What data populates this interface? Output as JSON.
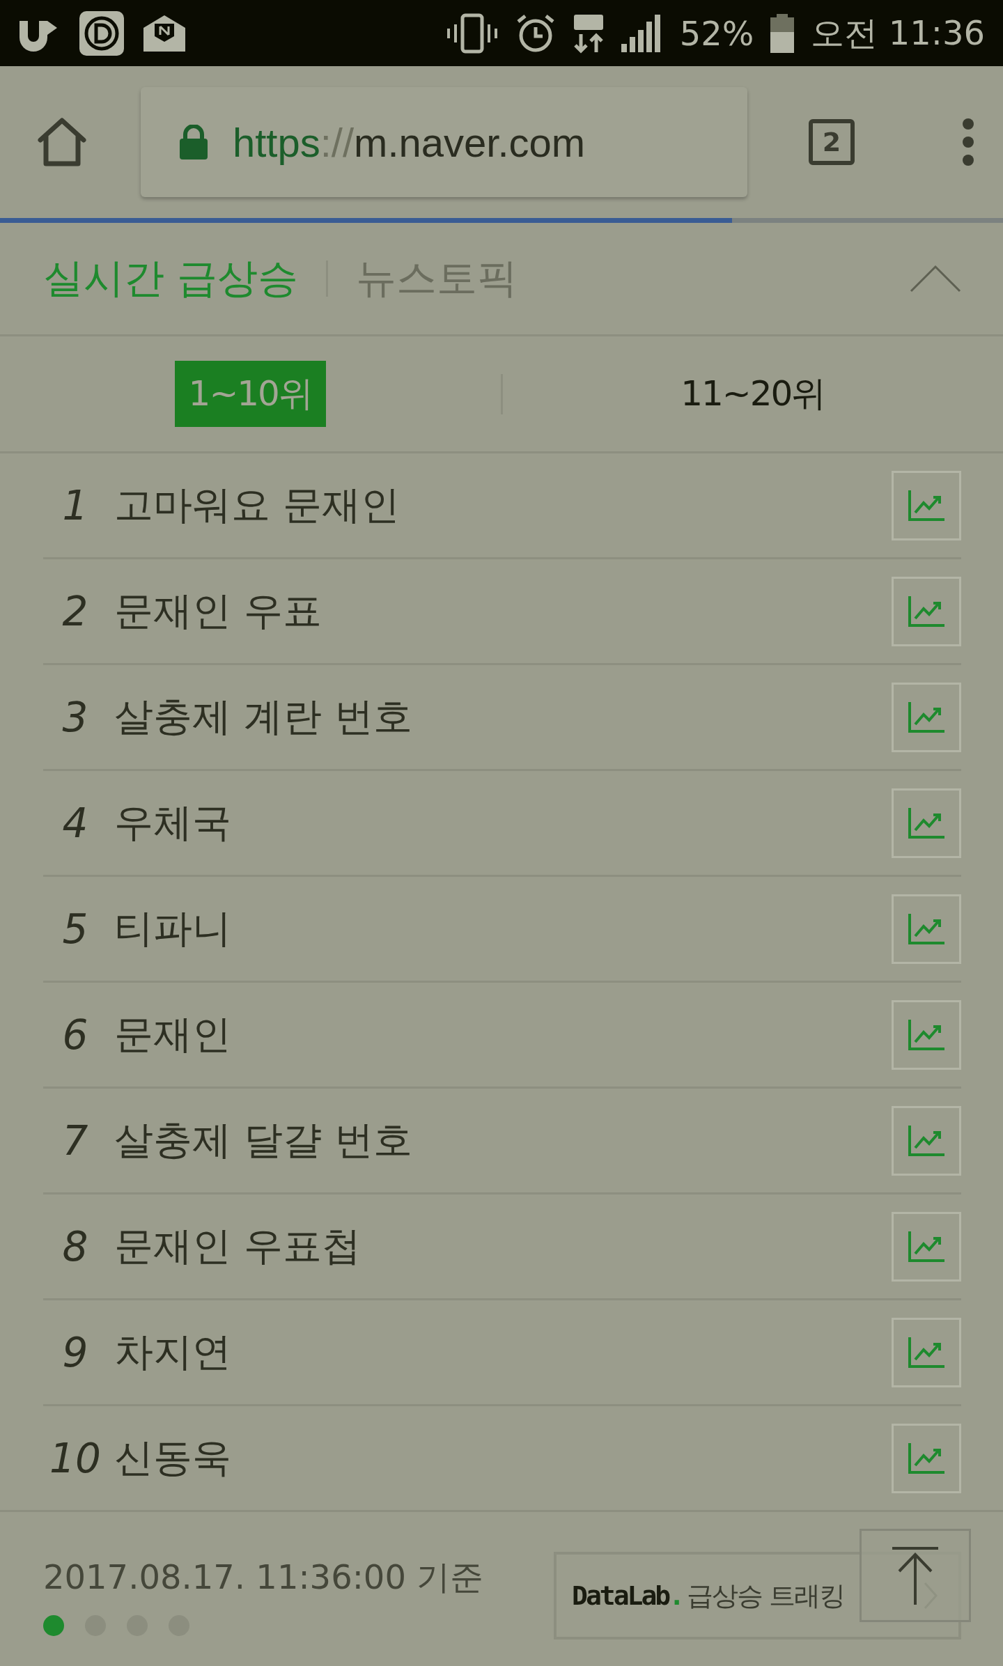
{
  "status_bar": {
    "battery": "52%",
    "time": "오전 11:36"
  },
  "browser": {
    "url_scheme": "https",
    "url_separator": "://",
    "url_host": "m.naver.com",
    "tab_count": "2",
    "load_progress": {
      "level": 0.73
    }
  },
  "section_tabs": [
    {
      "label": "실시간 급상승",
      "selected": true
    },
    {
      "label": "뉴스토픽",
      "selected": false
    }
  ],
  "range_tabs": [
    {
      "label": "1~10위",
      "selected": true
    },
    {
      "label": "11~20위",
      "selected": false
    }
  ],
  "rows": [
    {
      "rank": "1",
      "keyword": "고마워요 문재인"
    },
    {
      "rank": "2",
      "keyword": "문재인 우표"
    },
    {
      "rank": "3",
      "keyword": "살충제 계란 번호"
    },
    {
      "rank": "4",
      "keyword": "우체국"
    },
    {
      "rank": "5",
      "keyword": "티파니"
    },
    {
      "rank": "6",
      "keyword": "문재인"
    },
    {
      "rank": "7",
      "keyword": "살충제 달걀 번호"
    },
    {
      "rank": "8",
      "keyword": "문재인 우표첩"
    },
    {
      "rank": "9",
      "keyword": "차지연"
    },
    {
      "rank": "10",
      "keyword": "신동욱"
    }
  ],
  "footer": {
    "timestamp": "2017.08.17. 11:36:00 기준",
    "pages": [
      {
        "selected": true
      },
      {
        "selected": false
      },
      {
        "selected": false
      },
      {
        "selected": false
      }
    ],
    "datalab": {
      "brand": "DataLab",
      "brand_dot": ".",
      "label": "급상승 트래킹"
    }
  }
}
